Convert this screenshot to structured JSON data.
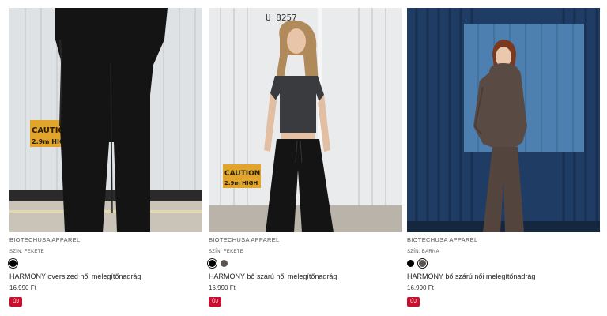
{
  "products": [
    {
      "brand": "BIOTECHUSA APPAREL",
      "color_label": "SZÍN: FEKETE",
      "swatches": [
        {
          "color": "#000000",
          "selected": true
        }
      ],
      "title": "HARMONY oversized női melegítőnadrág",
      "price": "16.990 Ft",
      "badge": "ÚJ",
      "photo_sign": [
        "CAUTION",
        "2.9m HIGH"
      ]
    },
    {
      "brand": "BIOTECHUSA APPAREL",
      "color_label": "SZÍN: FEKETE",
      "swatches": [
        {
          "color": "#000000",
          "selected": true
        },
        {
          "color": "#5a5550",
          "selected": false
        }
      ],
      "title": "HARMONY bő szárú női melegítőnadrág",
      "price": "16.990 Ft",
      "badge": "ÚJ",
      "photo_sign": [
        "CAUTION",
        "2.9m HIGH"
      ],
      "photo_container_id": "U 8257"
    },
    {
      "brand": "BIOTECHUSA APPAREL",
      "color_label": "SZÍN: BARNA",
      "swatches": [
        {
          "color": "#000000",
          "selected": false
        },
        {
          "color": "#5a5550",
          "selected": true
        }
      ],
      "title": "HARMONY bő szárú női melegítőnadrág",
      "price": "16.990 Ft",
      "badge": "ÚJ"
    }
  ],
  "colors": {
    "badge": "#c8102e",
    "black": "#000000",
    "brown": "#5a5550"
  }
}
